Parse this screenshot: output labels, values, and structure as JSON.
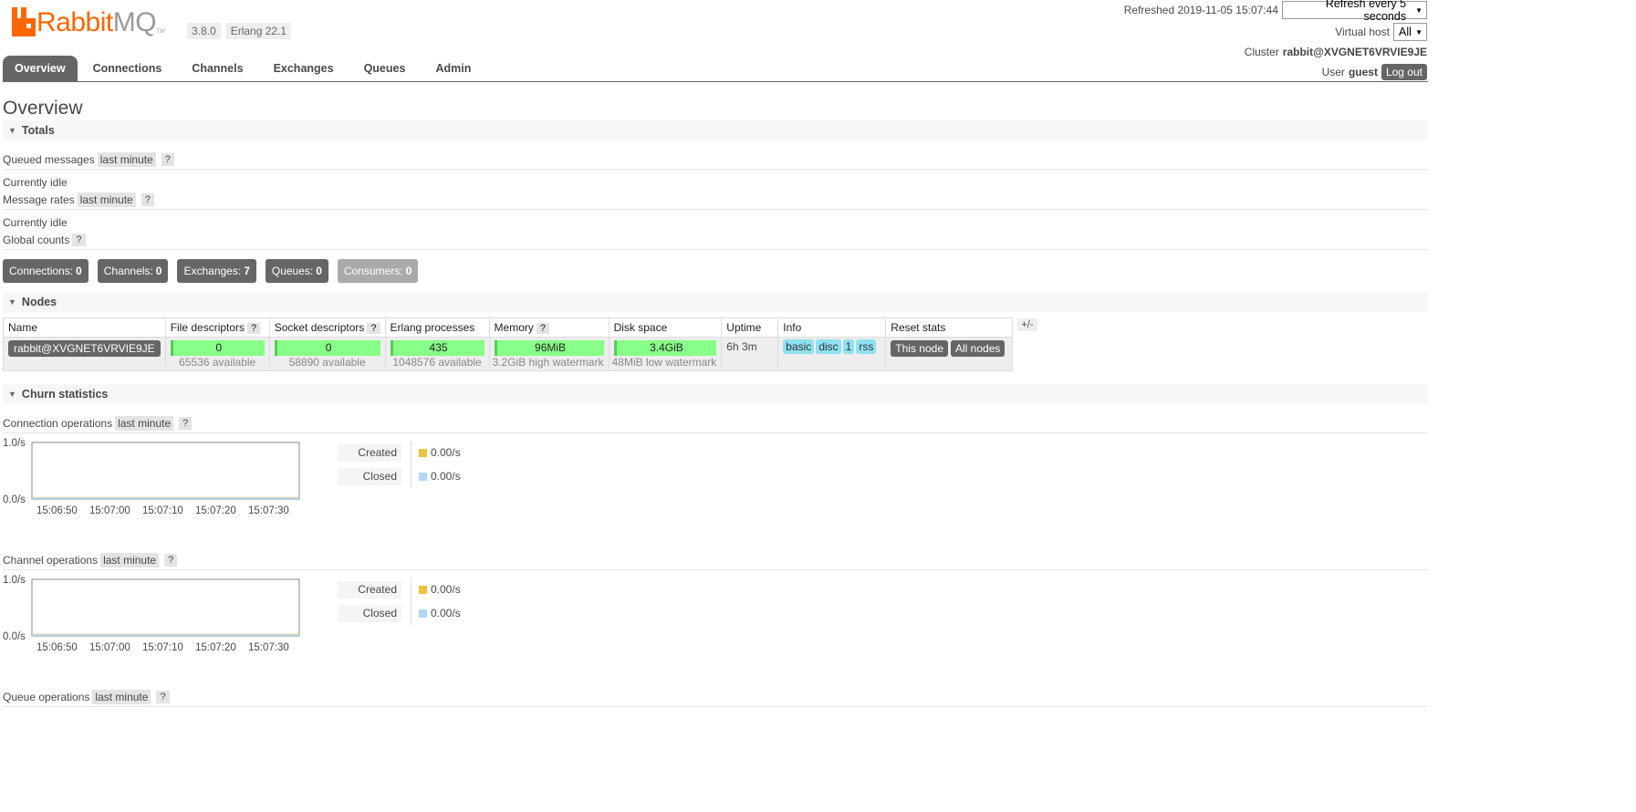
{
  "header": {
    "logo": {
      "part1": "Rabbit",
      "part2": "MQ",
      "tm": "TM"
    },
    "version": "3.8.0",
    "erlang": "Erlang 22.1",
    "refreshed": "Refreshed 2019-11-05 15:07:44",
    "refresh_select": "Refresh every 5 seconds",
    "vhost_label": "Virtual host",
    "vhost_value": "All",
    "cluster_label": "Cluster",
    "cluster_value": "rabbit@XVGNET6VRVIE9JE",
    "user_label": "User",
    "user_value": "guest",
    "logout": "Log out"
  },
  "tabs": [
    "Overview",
    "Connections",
    "Channels",
    "Exchanges",
    "Queues",
    "Admin"
  ],
  "page_title": "Overview",
  "totals": {
    "title": "Totals",
    "queued_label": "Queued messages",
    "queued_period": "last minute",
    "help": "?",
    "idle1": "Currently idle",
    "rates_label": "Message rates",
    "rates_period": "last minute",
    "idle2": "Currently idle",
    "global_label": "Global counts"
  },
  "counts": [
    {
      "label": "Connections:",
      "value": "0"
    },
    {
      "label": "Channels:",
      "value": "0"
    },
    {
      "label": "Exchanges:",
      "value": "7"
    },
    {
      "label": "Queues:",
      "value": "0"
    },
    {
      "label": "Consumers:",
      "value": "0"
    }
  ],
  "nodes": {
    "title": "Nodes",
    "headers": [
      "Name",
      "File descriptors",
      "Socket descriptors",
      "Erlang processes",
      "Memory",
      "Disk space",
      "Uptime",
      "Info",
      "Reset stats"
    ],
    "plus_minus": "+/-",
    "row": {
      "name": "rabbit@XVGNET6VRVIE9JE",
      "fd": "0",
      "fd_sub": "65536 available",
      "sd": "0",
      "sd_sub": "58890 available",
      "ep": "435",
      "ep_sub": "1048576 available",
      "mem": "96MiB",
      "mem_sub": "3.2GiB high watermark",
      "disk": "3.4GiB",
      "disk_sub": "48MiB low watermark",
      "uptime": "6h 3m",
      "info": [
        "basic",
        "disc",
        "1",
        "rss"
      ],
      "reset": [
        "This node",
        "All nodes"
      ]
    }
  },
  "churn": {
    "title": "Churn statistics",
    "charts": [
      {
        "label": "Connection operations",
        "period": "last minute"
      },
      {
        "label": "Channel operations",
        "period": "last minute"
      }
    ],
    "y_top": "1.0/s",
    "y_bottom": "0.0/s",
    "x_ticks": [
      "15:06:50",
      "15:07:00",
      "15:07:10",
      "15:07:20",
      "15:07:30"
    ],
    "legend": [
      {
        "label": "Created",
        "value": "0.00/s",
        "color": "#edc240"
      },
      {
        "label": "Closed",
        "value": "0.00/s",
        "color": "#afd8f8"
      }
    ],
    "queue_ops_label": "Queue operations",
    "queue_ops_period": "last minute"
  }
}
